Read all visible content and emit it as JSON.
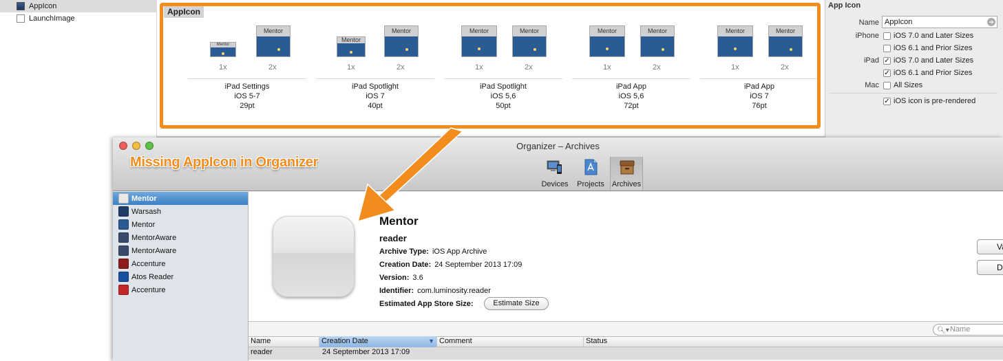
{
  "xcode": {
    "asset_list": [
      {
        "label": "AppIcon",
        "selected": true
      },
      {
        "label": "LaunchImage",
        "selected": false
      }
    ],
    "canvas_title": "AppIcon",
    "icon_thumb_caption": "Mentor",
    "scale_1x": "1x",
    "scale_2x": "2x",
    "groups": [
      {
        "device": "iPad Settings",
        "os": "iOS 5-7",
        "size": "29pt"
      },
      {
        "device": "iPad Spotlight",
        "os": "iOS 7",
        "size": "40pt"
      },
      {
        "device": "iPad Spotlight",
        "os": "iOS 5,6",
        "size": "50pt"
      },
      {
        "device": "iPad App",
        "os": "iOS 5,6",
        "size": "72pt"
      },
      {
        "device": "iPad App",
        "os": "iOS 7",
        "size": "76pt"
      }
    ],
    "highlight_color": "#f28c1d"
  },
  "inspector": {
    "title": "App Icon",
    "name_label": "Name",
    "name_value": "AppIcon",
    "iphone_label": "iPhone",
    "ipad_label": "iPad",
    "mac_label": "Mac",
    "options": {
      "iphone_ios7": {
        "label": "iOS 7.0 and Later Sizes",
        "checked": false
      },
      "iphone_ios6": {
        "label": "iOS 6.1 and Prior Sizes",
        "checked": false
      },
      "ipad_ios7": {
        "label": "iOS 7.0 and Later Sizes",
        "checked": true
      },
      "ipad_ios6": {
        "label": "iOS 6.1 and Prior Sizes",
        "checked": true
      },
      "mac_all": {
        "label": "All Sizes",
        "checked": false
      },
      "prerendered": {
        "label": "iOS icon is pre-rendered",
        "checked": true
      }
    },
    "check_glyph": "✓"
  },
  "annotation": {
    "text": "Missing AppIcon in Organizer"
  },
  "organizer": {
    "window_title": "Organizer – Archives",
    "toolbar": [
      {
        "label": "Devices",
        "active": false
      },
      {
        "label": "Projects",
        "active": false
      },
      {
        "label": "Archives",
        "active": true
      }
    ],
    "sidebar": [
      {
        "label": "Mentor",
        "selected": true,
        "color": "#e8e8e8"
      },
      {
        "label": "Warsash",
        "selected": false,
        "color": "#1f3c66"
      },
      {
        "label": "Mentor",
        "selected": false,
        "color": "#2b5b93"
      },
      {
        "label": "MentorAware",
        "selected": false,
        "color": "#3a4a6a"
      },
      {
        "label": "MentorAware",
        "selected": false,
        "color": "#3a4a6a"
      },
      {
        "label": "Accenture",
        "selected": false,
        "color": "#8a1c1c"
      },
      {
        "label": "Atos Reader",
        "selected": false,
        "color": "#1a4fa0"
      },
      {
        "label": "Accenture",
        "selected": false,
        "color": "#c22a2a"
      }
    ],
    "detail": {
      "app_name": "Mentor",
      "scheme": "reader",
      "archive_type_label": "Archive Type:",
      "archive_type_value": "iOS App Archive",
      "creation_date_label": "Creation Date:",
      "creation_date_value": "24 September 2013 17:09",
      "version_label": "Version:",
      "version_value": "3.6",
      "identifier_label": "Identifier:",
      "identifier_value": "com.luminosity.reader",
      "size_label": "Estimated App Store Size:",
      "estimate_button": "Estimate Size",
      "side_button_1": "Va",
      "side_button_2": "Dis"
    },
    "search_placeholder": "Name",
    "table": {
      "columns": [
        "Name",
        "Creation Date",
        "Comment",
        "Status"
      ],
      "sort_indicator": "▼",
      "rows": [
        {
          "name": "reader",
          "creation_date": "24 September 2013 17:09",
          "comment": "",
          "status": ""
        }
      ]
    }
  }
}
